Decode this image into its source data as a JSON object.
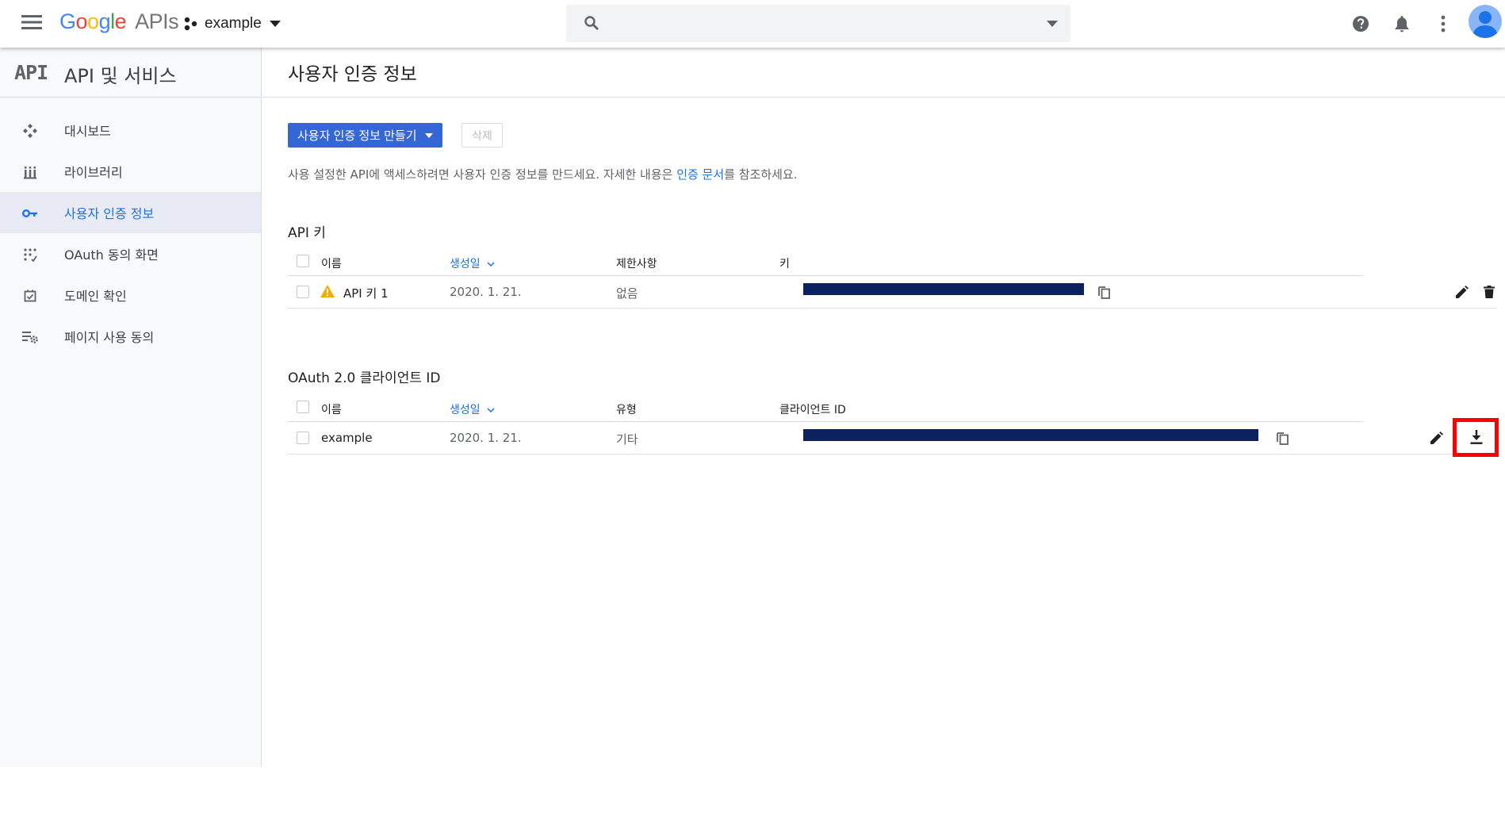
{
  "app": {
    "logo_google": "Google",
    "logo_apis": "APIs",
    "project_name": "example",
    "search_placeholder": ""
  },
  "sidebar": {
    "logo": "API",
    "title": "API 및 서비스",
    "items": [
      {
        "label": "대시보드",
        "icon": "dashboard-icon"
      },
      {
        "label": "라이브러리",
        "icon": "library-icon"
      },
      {
        "label": "사용자 인증 정보",
        "icon": "key-icon",
        "active": true
      },
      {
        "label": "OAuth 동의 화면",
        "icon": "oauth-consent-icon"
      },
      {
        "label": "도메인 확인",
        "icon": "domain-verify-icon"
      },
      {
        "label": "페이지 사용 동의",
        "icon": "page-usage-settings-icon"
      }
    ]
  },
  "main": {
    "title": "사용자 인증 정보",
    "create_button": "사용자 인증 정보 만들기",
    "delete_button": "삭제",
    "description_before": "사용 설정한 API에 액세스하려면 사용자 인증 정보를 만드세요. 자세한 내용은 ",
    "description_link": "인증 문서",
    "description_after": "를 참조하세요.",
    "api_keys": {
      "title": "API 키",
      "columns": [
        "이름",
        "생성일",
        "제한사항",
        "키"
      ],
      "rows": [
        {
          "name": "API 키 1",
          "created": "2020. 1. 21.",
          "restriction": "없음",
          "warning": true
        }
      ]
    },
    "oauth": {
      "title": "OAuth 2.0 클라이언트 ID",
      "columns": [
        "이름",
        "생성일",
        "유형",
        "클라이언트 ID"
      ],
      "rows": [
        {
          "name": "example",
          "created": "2020. 1. 21.",
          "type": "기타"
        }
      ]
    }
  },
  "colors": {
    "primary": "#3367d6",
    "link": "#1a73e8",
    "redaction": "#0b2160",
    "highlight": "#ff0000",
    "warning": "#f9ab00"
  }
}
